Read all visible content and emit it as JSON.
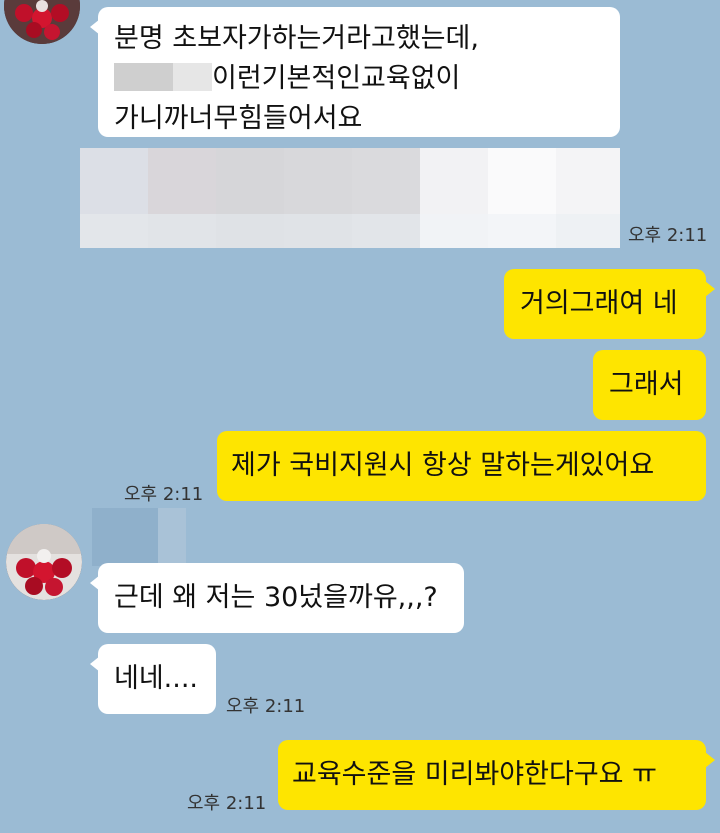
{
  "messages": {
    "m1": {
      "line1": "분명 초보자가하는거라고했는데,",
      "line2": "이런기본적인교육없이",
      "line3": "가니까너무힘들어서요"
    },
    "t1": "오후 2:11",
    "m2": "거의그래여 네",
    "m3": "그래서",
    "m4": "제가 국비지원시 항상 말하는게있어요",
    "t2": "오후 2:11",
    "m5": "근데 왜 저는 30넜을까유,,,?",
    "m6": "네네....",
    "t3": "오후 2:11",
    "m7": "교육수준을 미리봐야한다구요 ㅠ",
    "t4": "오후 2:11"
  },
  "colors": {
    "background": "#9bbbd4",
    "incoming_bubble": "#ffffff",
    "outgoing_bubble": "#fee500"
  }
}
